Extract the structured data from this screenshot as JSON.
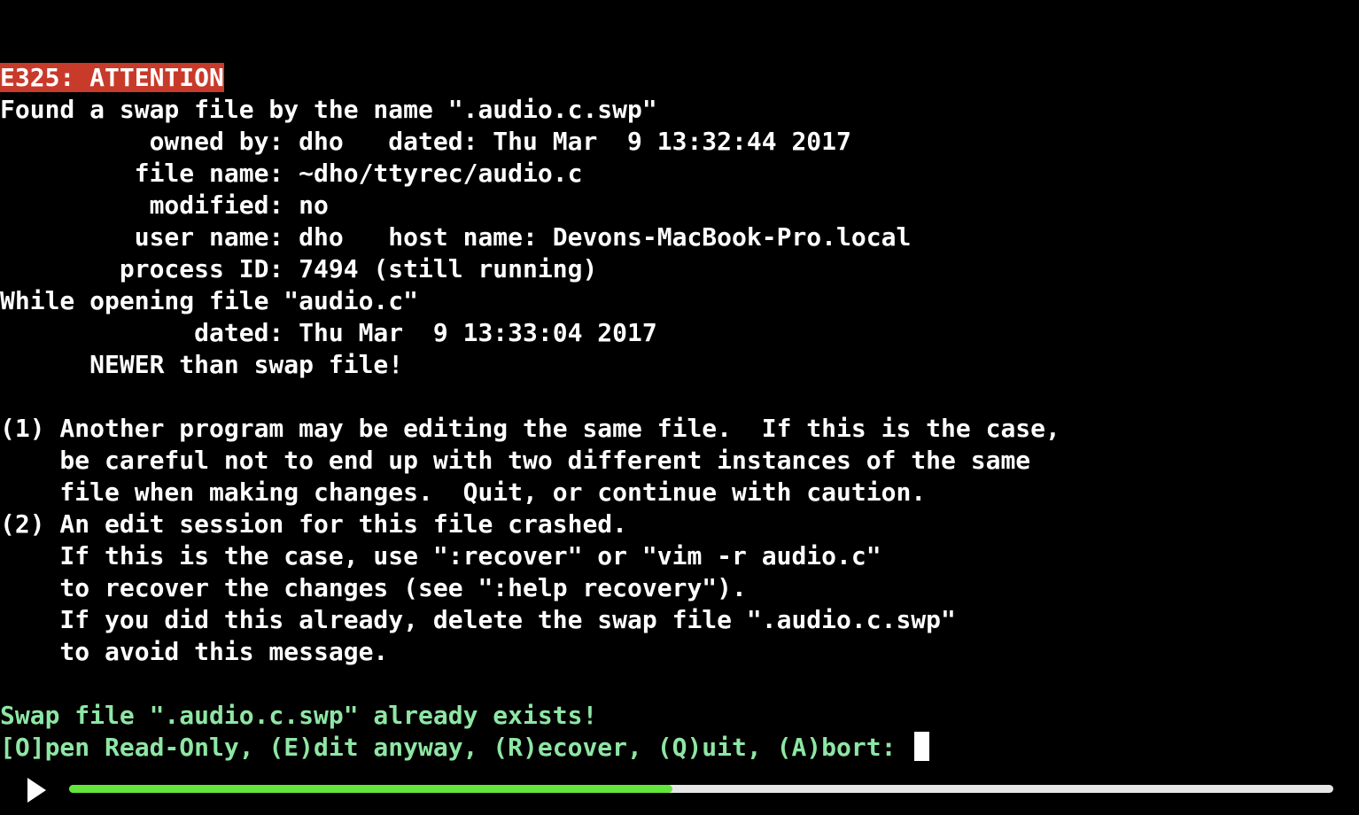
{
  "terminal": {
    "lines": [
      {
        "text": "E325: ATTENTION",
        "style": "attention"
      },
      {
        "text": "Found a swap file by the name \".audio.c.swp\"",
        "style": "normal"
      },
      {
        "text": "          owned by: dho   dated: Thu Mar  9 13:32:44 2017",
        "style": "normal"
      },
      {
        "text": "         file name: ~dho/ttyrec/audio.c",
        "style": "normal"
      },
      {
        "text": "          modified: no",
        "style": "normal"
      },
      {
        "text": "         user name: dho   host name: Devons-MacBook-Pro.local",
        "style": "normal"
      },
      {
        "text": "        process ID: 7494 (still running)",
        "style": "normal"
      },
      {
        "text": "While opening file \"audio.c\"",
        "style": "normal"
      },
      {
        "text": "             dated: Thu Mar  9 13:33:04 2017",
        "style": "normal"
      },
      {
        "text": "      NEWER than swap file!",
        "style": "normal"
      },
      {
        "text": "",
        "style": "normal"
      },
      {
        "text": "(1) Another program may be editing the same file.  If this is the case,",
        "style": "normal"
      },
      {
        "text": "    be careful not to end up with two different instances of the same",
        "style": "normal"
      },
      {
        "text": "    file when making changes.  Quit, or continue with caution.",
        "style": "normal"
      },
      {
        "text": "(2) An edit session for this file crashed.",
        "style": "normal"
      },
      {
        "text": "    If this is the case, use \":recover\" or \"vim -r audio.c\"",
        "style": "normal"
      },
      {
        "text": "    to recover the changes (see \":help recovery\").",
        "style": "normal"
      },
      {
        "text": "    If you did this already, delete the swap file \".audio.c.swp\"",
        "style": "normal"
      },
      {
        "text": "    to avoid this message.",
        "style": "normal"
      },
      {
        "text": "",
        "style": "normal"
      },
      {
        "text": "Swap file \".audio.c.swp\" already exists!",
        "style": "green"
      },
      {
        "text": "[O]pen Read-Only, (E)dit anyway, (R)ecover, (Q)uit, (A)bort: ",
        "style": "green",
        "cursor": true
      }
    ],
    "colors": {
      "background": "#000000",
      "foreground": "#ffffff",
      "attention_bg": "#c83a2a",
      "prompt": "#8ee6a4"
    }
  },
  "player": {
    "play_icon": "play-icon",
    "progress": 0.477,
    "colors": {
      "track": "#e6e6e6",
      "fill": "#63e63b"
    }
  }
}
